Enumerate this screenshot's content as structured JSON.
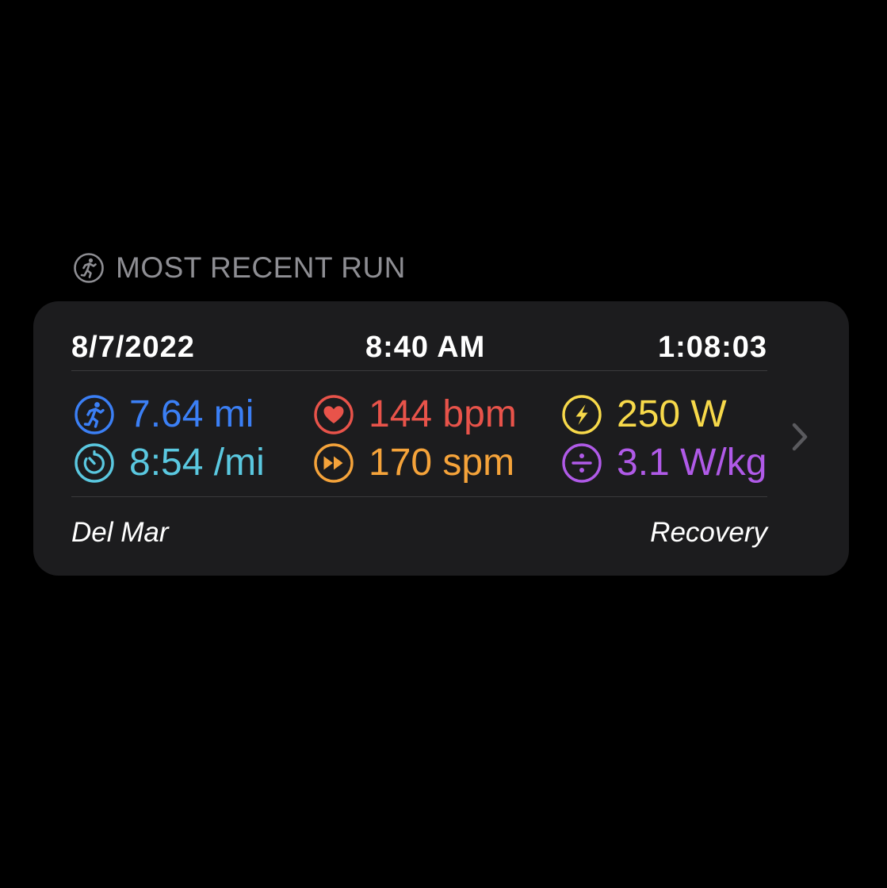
{
  "section": {
    "title": "MOST RECENT RUN",
    "icon": "runner-circle-icon"
  },
  "run": {
    "date": "8/7/2022",
    "time": "8:40 AM",
    "duration": "1:08:03",
    "location": "Del Mar",
    "workout_type": "Recovery"
  },
  "metrics": {
    "distance": {
      "value": "7.64 mi",
      "icon": "runner-icon",
      "color": "#3b7ff5"
    },
    "pace": {
      "value": "8:54 /mi",
      "icon": "stopwatch-icon",
      "color": "#5ac8e0"
    },
    "heart_rate": {
      "value": "144 bpm",
      "icon": "heart-icon",
      "color": "#e8534a"
    },
    "cadence": {
      "value": "170 spm",
      "icon": "fast-forward-icon",
      "color": "#f5a33a"
    },
    "power": {
      "value": "250 W",
      "icon": "lightning-icon",
      "color": "#f7d94a"
    },
    "power_weight": {
      "value": "3.1 W/kg",
      "icon": "divide-icon",
      "color": "#b05ae8"
    }
  },
  "colors": {
    "background": "#000000",
    "card": "#1c1c1e",
    "header_text": "#8e8e93",
    "divider": "#3a3a3c",
    "chevron": "#5a5a5e"
  }
}
